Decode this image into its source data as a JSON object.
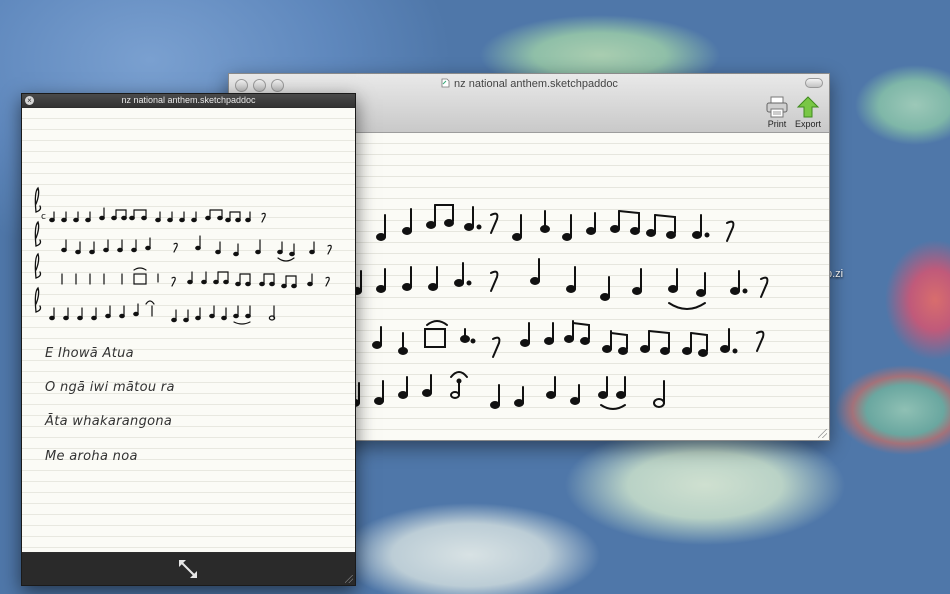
{
  "desktop": {
    "label": "p.zi"
  },
  "back_window": {
    "title": "nz national anthem.sketchpaddoc",
    "toolbar": {
      "print_label": "Print",
      "export_label": "Export"
    }
  },
  "front_window": {
    "title": "nz national anthem.sketchpaddoc",
    "lyrics": [
      "E Ihowā Atua",
      "O ngā iwi mātou ra",
      "Āta whakarangona",
      "Me aroha noa"
    ]
  },
  "colors": {
    "ink": "#111111",
    "paper": "#fbfbf6",
    "export_arrow": "#6fbf3a"
  }
}
